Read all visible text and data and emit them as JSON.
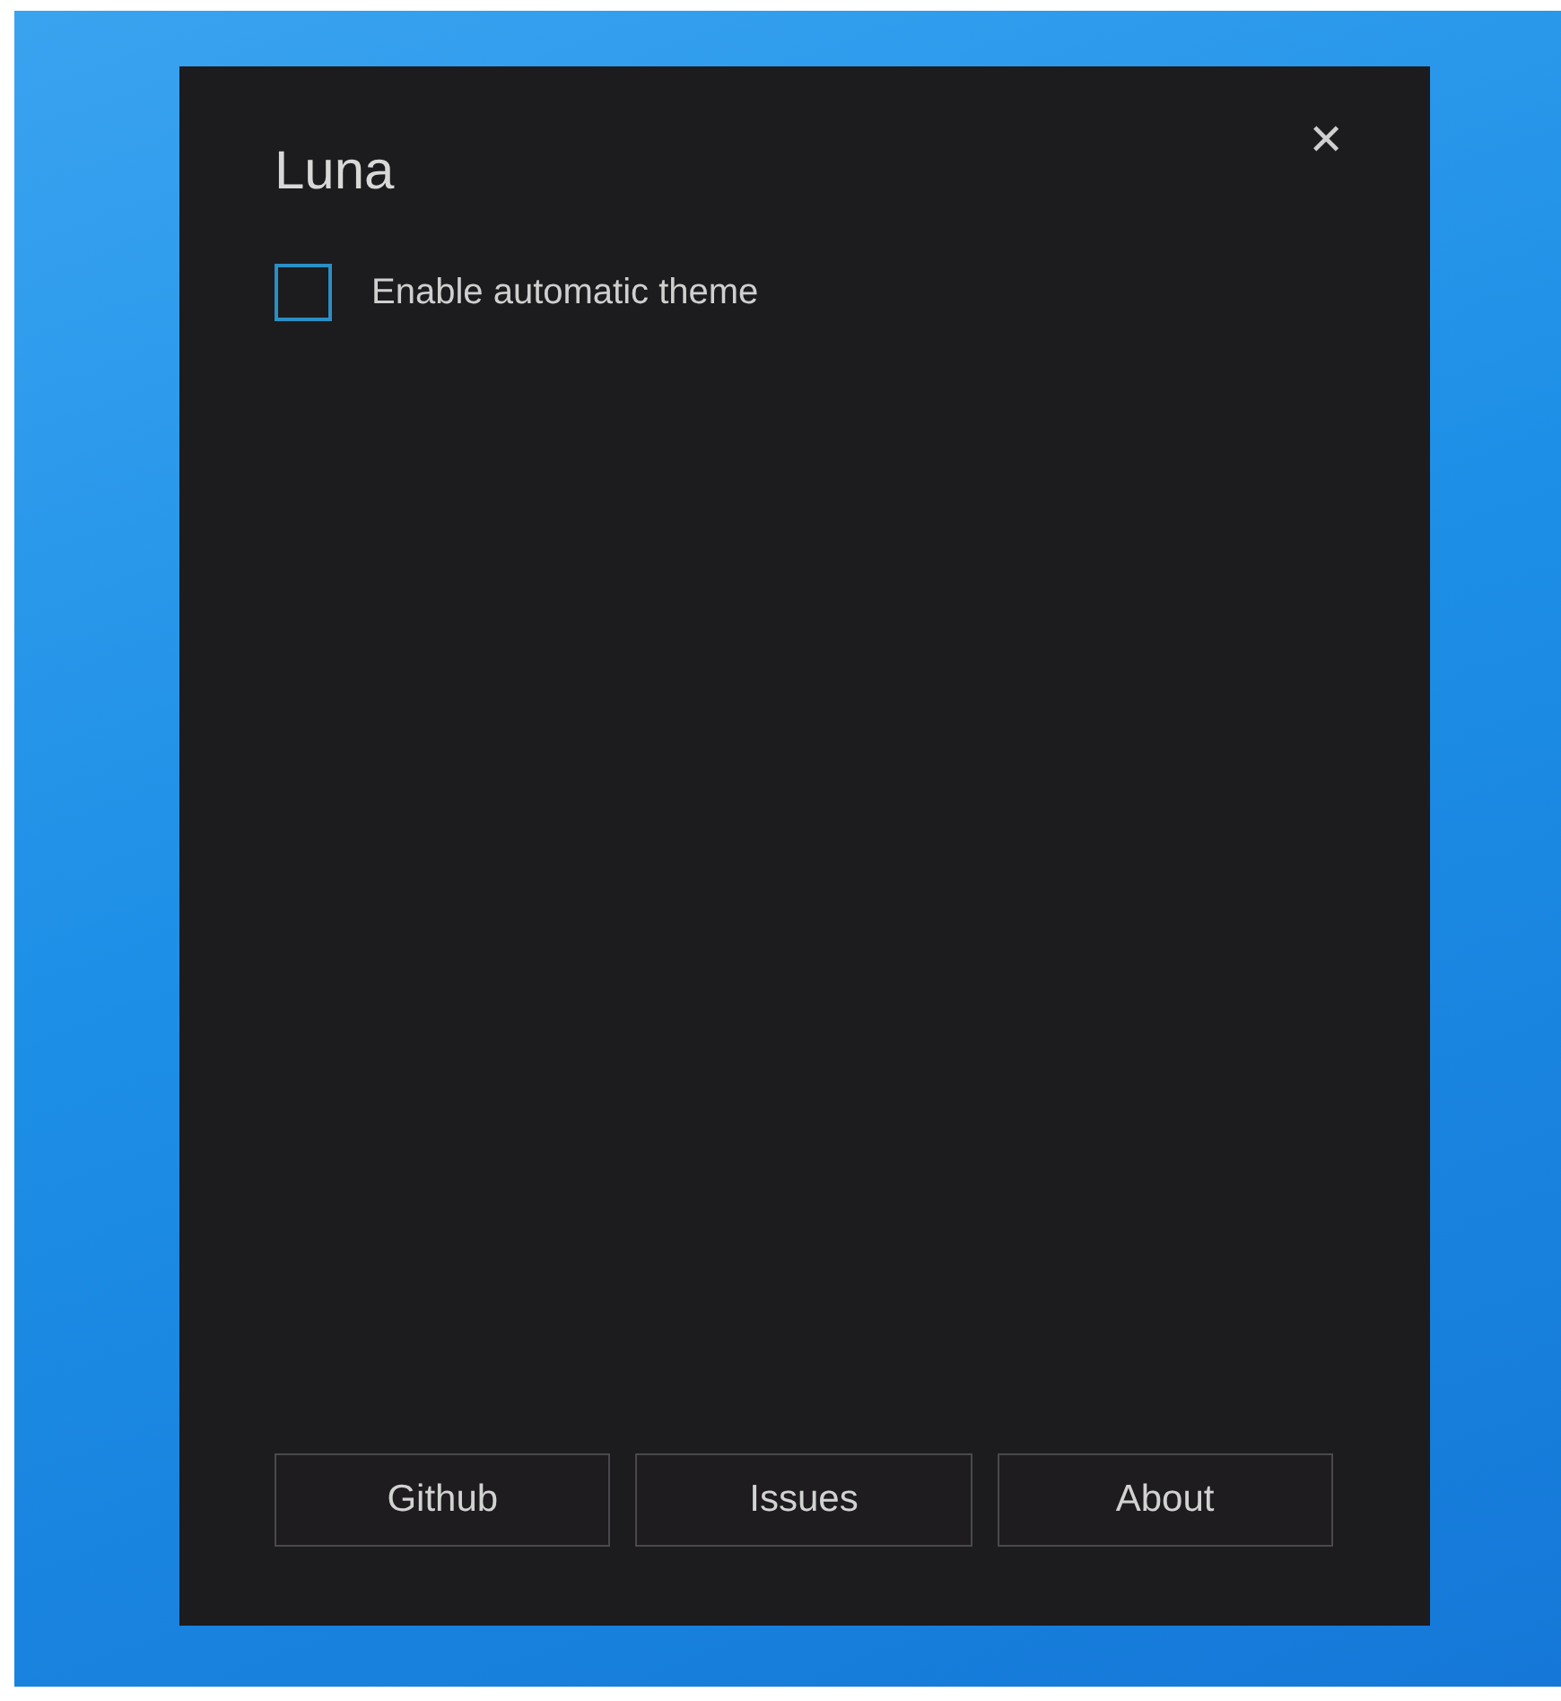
{
  "window": {
    "title": "Luna",
    "close": "✕"
  },
  "option": {
    "label": "Enable automatic theme",
    "checked": false
  },
  "buttons": [
    "Github",
    "Issues",
    "About"
  ]
}
